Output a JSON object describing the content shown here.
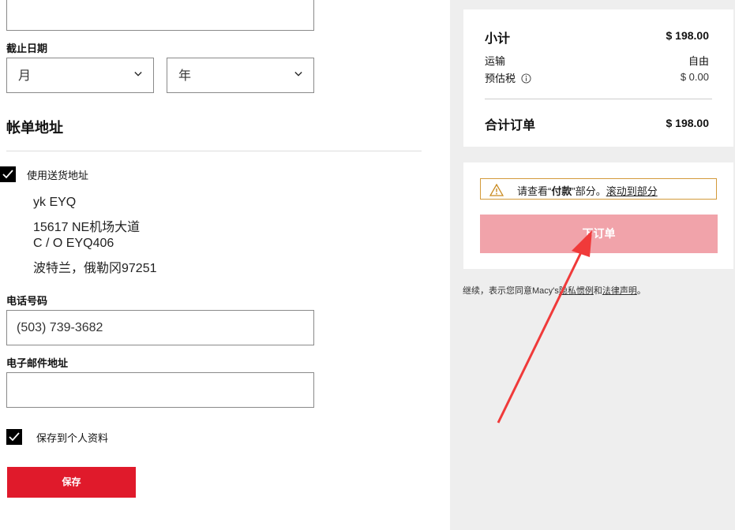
{
  "payment": {
    "expiry_label": "截止日期",
    "month_placeholder": "月",
    "year_placeholder": "年"
  },
  "billing": {
    "title": "帐单地址",
    "use_shipping_label": "使用送货地址",
    "address_lines": [
      "yk EYQ",
      "15617 NE机场大道",
      "C / O EYQ406",
      "波特兰，俄勒冈97251"
    ],
    "phone_label": "电话号码",
    "phone_value": "(503) 739-3682",
    "email_label": "电子邮件地址",
    "email_value": "",
    "save_profile_label": "保存到个人资料",
    "save_button": "保存"
  },
  "summary": {
    "subtotal_label": "小计",
    "subtotal_value": "$ 198.00",
    "shipping_label": "运输",
    "shipping_value": "自由",
    "tax_label": "预估税",
    "tax_value": "$ 0.00",
    "total_label": "合计订单",
    "total_value": "$ 198.00"
  },
  "alert": {
    "text_prefix": "请查看“",
    "text_bold": "付款",
    "text_suffix": "”部分。",
    "link": "滚动到部分"
  },
  "order": {
    "place_order_button": "下订单",
    "legal_prefix": "继续，表示您同意Macy's",
    "privacy_link": "隐私惯例",
    "legal_and": "和",
    "legal_link": "法律声明",
    "legal_end": "。"
  },
  "colors": {
    "accent_red": "#e01a2b",
    "disabled_button": "#f1a3aa",
    "alert_border": "#d39a3a",
    "arrow": "#f03a3a"
  }
}
